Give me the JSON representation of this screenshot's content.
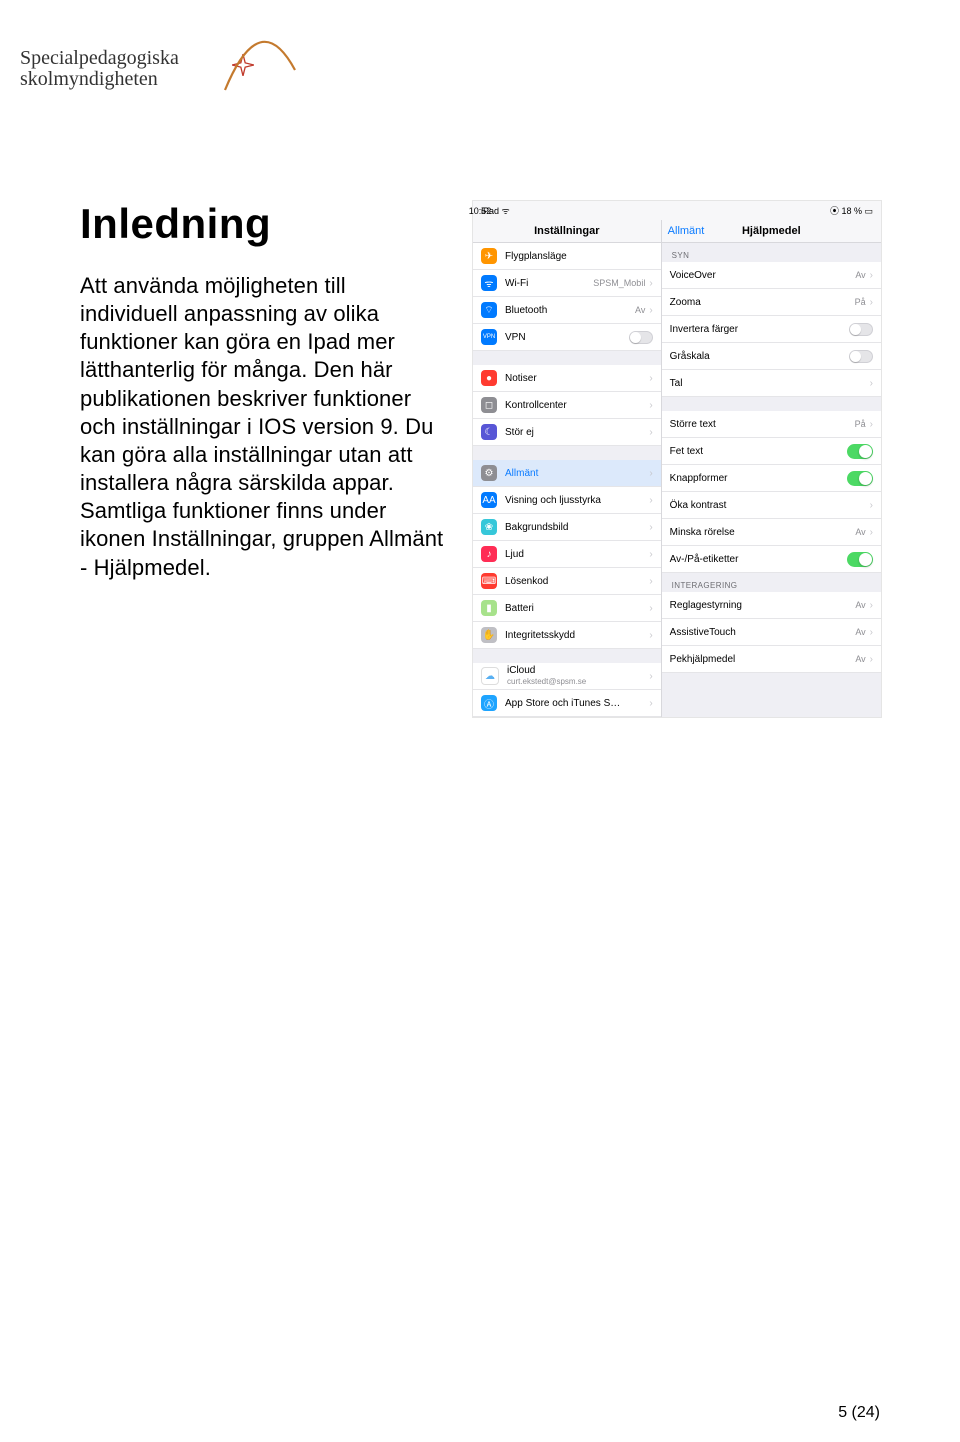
{
  "brand": {
    "line1": "Specialpedagogiska",
    "line2": "skolmyndigheten"
  },
  "heading": "Inledning",
  "body": "Att använda möjligheten till individuell anpassning av olika funktioner kan göra en Ipad mer lätthanterlig för många. Den här publikationen beskriver funktioner och inställningar i IOS version 9. Du kan göra alla inställningar utan att installera några särskilda appar. Samtliga funktioner finns under ikonen Inställningar, gruppen Allmänt - Hjälpmedel.",
  "page": "5 (24)",
  "ios": {
    "status": {
      "device": "iPad ᯤ",
      "time": "10:52",
      "battery": "⦿ 18 % ▭"
    },
    "sidebar": {
      "title": "Inställningar",
      "rows": [
        {
          "kind": "row",
          "icon": "#ff9500",
          "glyph": "✈︎",
          "label": "Flygplansläge",
          "value": "",
          "control": "toggle-off-partial"
        },
        {
          "kind": "row",
          "icon": "#007aff",
          "glyph": "ᯤ",
          "label": "Wi-Fi",
          "value": "SPSM_Mobil",
          "control": "chevron"
        },
        {
          "kind": "row",
          "icon": "#007aff",
          "glyph": "⌔",
          "label": "Bluetooth",
          "value": "Av",
          "control": "chevron"
        },
        {
          "kind": "row",
          "icon": "#007aff",
          "glyph": "VPN",
          "label": "VPN",
          "value": "",
          "control": "smalltoggle"
        },
        {
          "kind": "spacer"
        },
        {
          "kind": "row",
          "icon": "#ff3b30",
          "glyph": "●",
          "label": "Notiser",
          "value": "",
          "control": "chevron"
        },
        {
          "kind": "row",
          "icon": "#8e8e93",
          "glyph": "◻︎",
          "label": "Kontrollcenter",
          "value": "",
          "control": "chevron"
        },
        {
          "kind": "row",
          "icon": "#5856d6",
          "glyph": "☾",
          "label": "Stör ej",
          "value": "",
          "control": "chevron"
        },
        {
          "kind": "spacer"
        },
        {
          "kind": "row",
          "icon": "#8e8e93",
          "glyph": "⚙︎",
          "label": "Allmänt",
          "value": "",
          "control": "chevron",
          "selected": true
        },
        {
          "kind": "row",
          "icon": "#007aff",
          "glyph": "AA",
          "label": "Visning och ljusstyrka",
          "value": "",
          "control": "chevron"
        },
        {
          "kind": "row",
          "icon": "#36c7d9",
          "glyph": "❀",
          "label": "Bakgrundsbild",
          "value": "",
          "control": "chevron"
        },
        {
          "kind": "row",
          "icon": "#ff2d55",
          "glyph": "♪",
          "label": "Ljud",
          "value": "",
          "control": "chevron"
        },
        {
          "kind": "row",
          "icon": "#ff3b30",
          "glyph": "⌨︎",
          "label": "Lösenkod",
          "value": "",
          "control": "chevron"
        },
        {
          "kind": "row",
          "icon": "#a7e28b",
          "glyph": "▮",
          "label": "Batteri",
          "value": "",
          "control": "chevron"
        },
        {
          "kind": "row",
          "icon": "#bfbfc4",
          "glyph": "✋",
          "label": "Integritetsskydd",
          "value": "",
          "control": "chevron"
        },
        {
          "kind": "spacer"
        },
        {
          "kind": "row",
          "icon": "#ffffff",
          "glyph": "☁︎",
          "label": "iCloud",
          "value": "",
          "sub": "curt.ekstedt@spsm.se",
          "control": "chevron"
        },
        {
          "kind": "row",
          "icon": "#1ea4ff",
          "glyph": "Ⓐ",
          "label": "App Store och iTunes S…",
          "value": "",
          "control": "chevron"
        }
      ]
    },
    "main": {
      "back": "Allmänt",
      "title": "Hjälpmedel",
      "rows": [
        {
          "kind": "grouplab",
          "label": "SYN"
        },
        {
          "kind": "row",
          "label": "VoiceOver",
          "value": "Av",
          "control": "chevron"
        },
        {
          "kind": "row",
          "label": "Zooma",
          "value": "På",
          "control": "chevron"
        },
        {
          "kind": "row",
          "label": "Invertera färger",
          "value": "",
          "control": "smalltoggle"
        },
        {
          "kind": "row",
          "label": "Gråskala",
          "value": "",
          "control": "smalltoggle"
        },
        {
          "kind": "row",
          "label": "Tal",
          "value": "",
          "control": "chevron"
        },
        {
          "kind": "spacer"
        },
        {
          "kind": "row",
          "label": "Större text",
          "value": "På",
          "control": "chevron"
        },
        {
          "kind": "row",
          "label": "Fet text",
          "value": "",
          "control": "toggle-on"
        },
        {
          "kind": "row",
          "label": "Knappformer",
          "value": "",
          "control": "toggle-on"
        },
        {
          "kind": "row",
          "label": "Öka kontrast",
          "value": "",
          "control": "chevron"
        },
        {
          "kind": "row",
          "label": "Minska rörelse",
          "value": "Av",
          "control": "chevron"
        },
        {
          "kind": "row",
          "label": "Av-/På-etiketter",
          "value": "",
          "control": "toggle-on"
        },
        {
          "kind": "grouplab",
          "label": "INTERAGERING"
        },
        {
          "kind": "row",
          "label": "Reglagestyrning",
          "value": "Av",
          "control": "chevron"
        },
        {
          "kind": "row",
          "label": "AssistiveTouch",
          "value": "Av",
          "control": "chevron"
        },
        {
          "kind": "row",
          "label": "Pekhjälpmedel",
          "value": "Av",
          "control": "chevron"
        }
      ]
    }
  }
}
